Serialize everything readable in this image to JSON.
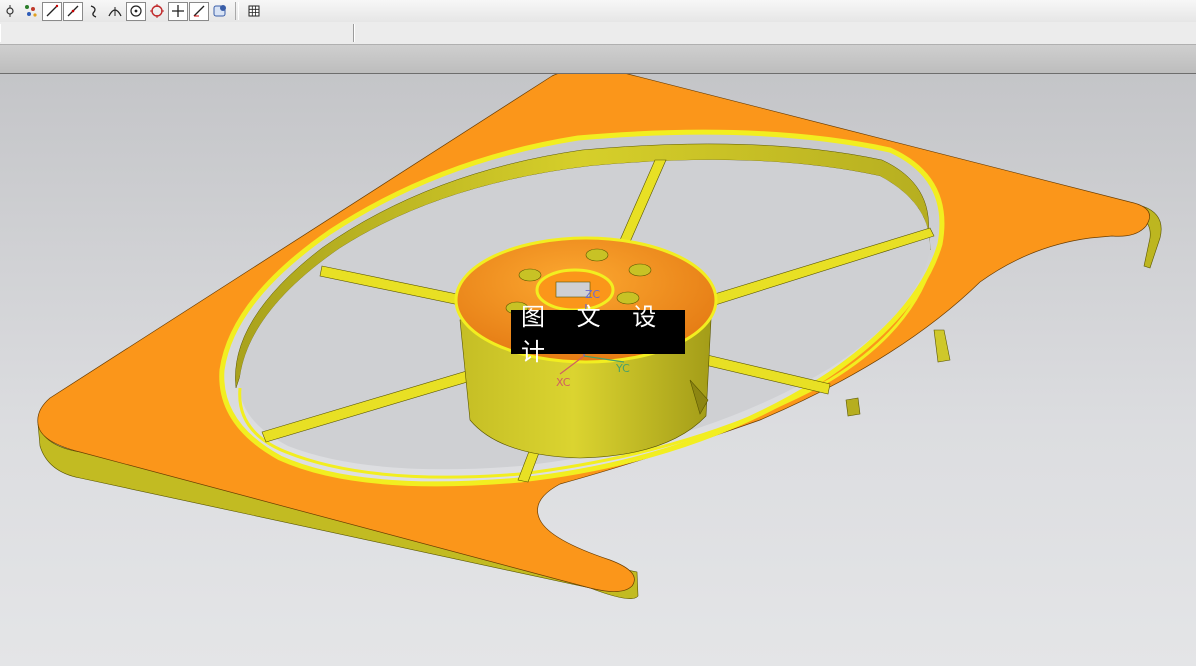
{
  "toolbar": {
    "icons": [
      "snap-icon",
      "point-cloud-icon",
      "line-icon",
      "line-tangent-icon",
      "curve-icon",
      "arc-icon",
      "center-point-icon",
      "circle-point-icon",
      "cross-point-icon",
      "angled-line-icon",
      "snap-dialog-icon",
      "grid-icon"
    ]
  },
  "viewport": {
    "watermark": "图 文 设 计",
    "axes": {
      "z": "ZC",
      "x": "XC",
      "y": "YC"
    },
    "colors": {
      "face_orange": "#fb961a",
      "wall_yellow": "#c9c327",
      "edge_highlight": "#f2ee20",
      "axis_x": "#d06060",
      "axis_y": "#4aa06a",
      "axis_z": "#6a6ad0"
    }
  }
}
